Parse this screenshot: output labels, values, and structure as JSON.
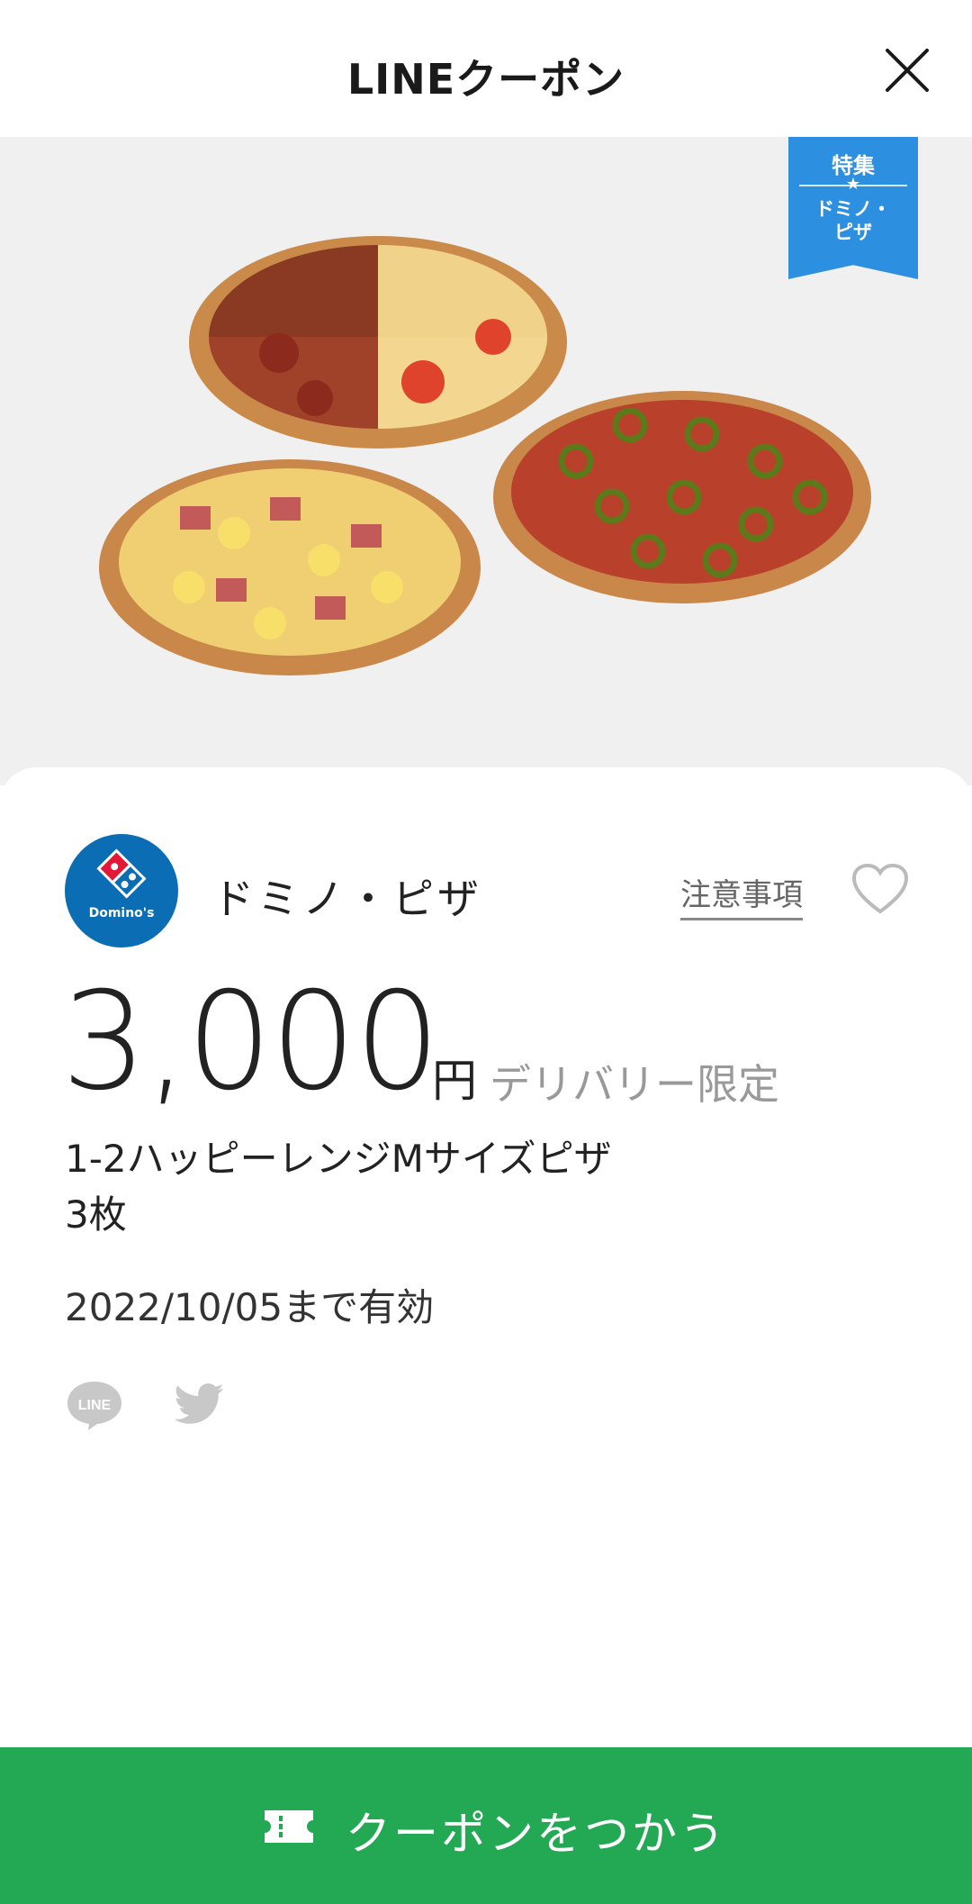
{
  "header": {
    "title": "LINEクーポン",
    "close_icon": "close-icon"
  },
  "hero": {
    "image": "pizza-photo",
    "badge": {
      "top": "特集",
      "star": "★",
      "bottom_line1": "ドミノ・",
      "bottom_line2": "ピザ",
      "color": "#2d8fdf"
    }
  },
  "coupon": {
    "logo_text": "Domino's",
    "brand": "ドミノ・ピザ",
    "notes_label": "注意事項",
    "amount": "3,000",
    "unit": "円",
    "limit_label": "デリバリー限定",
    "description_line1": "1-2ハッピーレンジMサイズピザ",
    "description_line2": "3枚",
    "valid_until": "2022/10/05まで有効"
  },
  "share": {
    "line_icon": "line-icon",
    "twitter_icon": "twitter-icon"
  },
  "cta": {
    "label": "クーポンをつかう",
    "color": "#23a853"
  }
}
